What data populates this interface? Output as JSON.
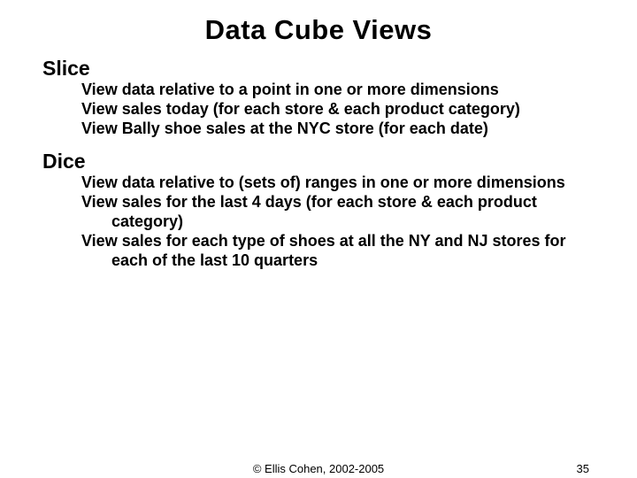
{
  "title": "Data Cube Views",
  "sections": [
    {
      "heading": "Slice",
      "items": [
        "View data relative to a point in one or more dimensions",
        "View sales today (for each store & each product category)",
        "View Bally shoe sales at the NYC store (for each date)"
      ]
    },
    {
      "heading": "Dice",
      "items": [
        "View data relative to (sets of) ranges in one or more dimensions",
        "View sales for the last 4 days (for each store & each product category)",
        "View sales for each type of shoes at all the NY and NJ stores for each of the last 10 quarters"
      ]
    }
  ],
  "footer": {
    "copyright": "© Ellis Cohen, 2002-2005",
    "page": "35"
  }
}
